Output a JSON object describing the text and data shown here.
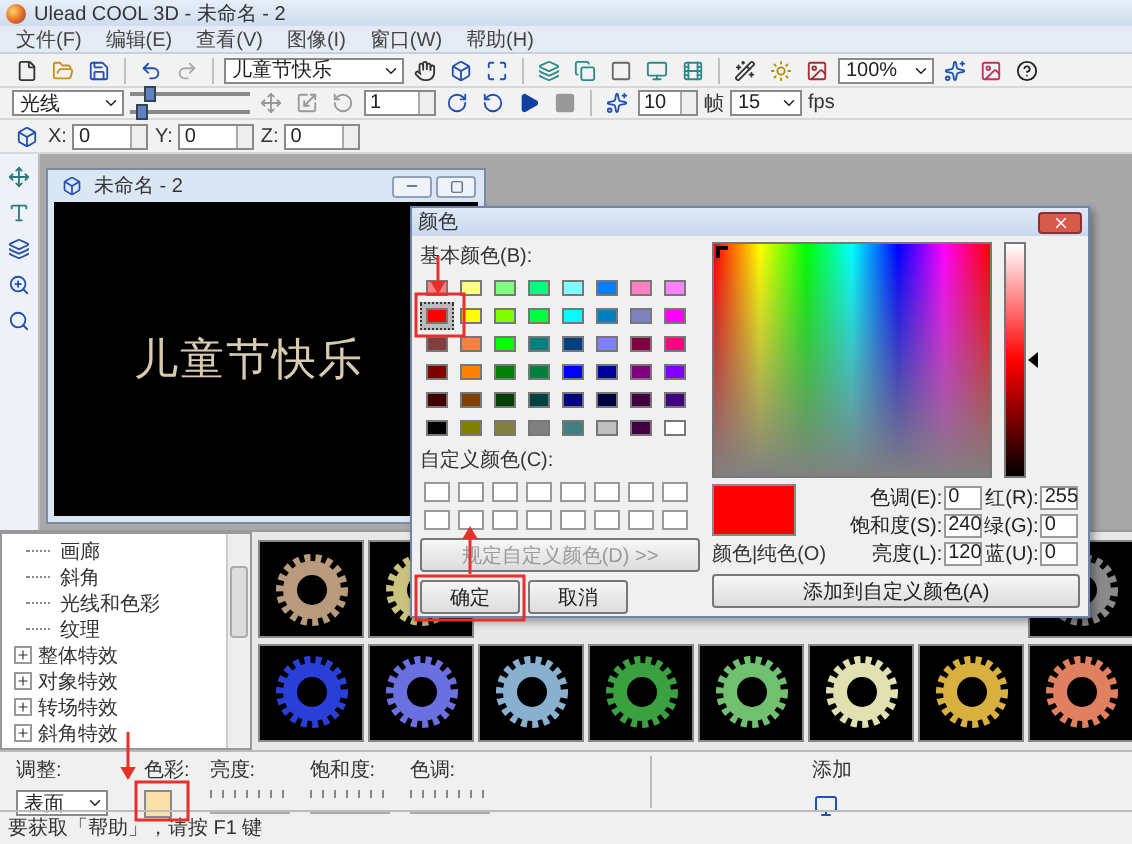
{
  "window": {
    "title": "Ulead COOL 3D - 未命名 - 2"
  },
  "menu": [
    "文件(F)",
    "编辑(E)",
    "查看(V)",
    "图像(I)",
    "窗口(W)",
    "帮助(H)"
  ],
  "toolbar": {
    "text_dropdown": "儿童节快乐",
    "zoom_dropdown": "100%",
    "effect_dropdown": "光线",
    "sliders": [
      {
        "level": 0.12
      },
      {
        "level": 0.05
      }
    ],
    "frame_spinner": "1",
    "frames_spinner": "10",
    "frames_label": "帧",
    "fps_dropdown": "15",
    "fps_label": "fps",
    "coords": [
      {
        "label": "X:",
        "value": "0"
      },
      {
        "label": "Y:",
        "value": "0"
      },
      {
        "label": "Z:",
        "value": "0"
      }
    ]
  },
  "document": {
    "title": "未命名 - 2",
    "canvas_text": "儿童节快乐"
  },
  "color_dialog": {
    "title": "颜色",
    "basic_label": "基本颜色(B):",
    "basic_colors": [
      {
        "color": "#ff8080",
        "selected": false
      },
      {
        "color": "#ffff80",
        "selected": false
      },
      {
        "color": "#80ff80",
        "selected": false
      },
      {
        "color": "#00ff80",
        "selected": false
      },
      {
        "color": "#80ffff",
        "selected": false
      },
      {
        "color": "#0080ff",
        "selected": false
      },
      {
        "color": "#ff80c0",
        "selected": false
      },
      {
        "color": "#ff80ff",
        "selected": false
      },
      {
        "color": "#ff0000",
        "selected": true
      },
      {
        "color": "#ffff00",
        "selected": false
      },
      {
        "color": "#80ff00",
        "selected": false
      },
      {
        "color": "#00ff40",
        "selected": false
      },
      {
        "color": "#00ffff",
        "selected": false
      },
      {
        "color": "#0080c0",
        "selected": false
      },
      {
        "color": "#8080c0",
        "selected": false
      },
      {
        "color": "#ff00ff",
        "selected": false
      },
      {
        "color": "#804040",
        "selected": false
      },
      {
        "color": "#ff8040",
        "selected": false
      },
      {
        "color": "#00ff00",
        "selected": false
      },
      {
        "color": "#008080",
        "selected": false
      },
      {
        "color": "#004080",
        "selected": false
      },
      {
        "color": "#8080ff",
        "selected": false
      },
      {
        "color": "#800040",
        "selected": false
      },
      {
        "color": "#ff0080",
        "selected": false
      },
      {
        "color": "#800000",
        "selected": false
      },
      {
        "color": "#ff8000",
        "selected": false
      },
      {
        "color": "#008000",
        "selected": false
      },
      {
        "color": "#008040",
        "selected": false
      },
      {
        "color": "#0000ff",
        "selected": false
      },
      {
        "color": "#0000a0",
        "selected": false
      },
      {
        "color": "#800080",
        "selected": false
      },
      {
        "color": "#8000ff",
        "selected": false
      },
      {
        "color": "#400000",
        "selected": false
      },
      {
        "color": "#804000",
        "selected": false
      },
      {
        "color": "#004000",
        "selected": false
      },
      {
        "color": "#004040",
        "selected": false
      },
      {
        "color": "#000080",
        "selected": false
      },
      {
        "color": "#000040",
        "selected": false
      },
      {
        "color": "#400040",
        "selected": false
      },
      {
        "color": "#400080",
        "selected": false
      },
      {
        "color": "#000000",
        "selected": false
      },
      {
        "color": "#808000",
        "selected": false
      },
      {
        "color": "#808040",
        "selected": false
      },
      {
        "color": "#808080",
        "selected": false
      },
      {
        "color": "#408080",
        "selected": false
      },
      {
        "color": "#c0c0c0",
        "selected": false
      },
      {
        "color": "#400040",
        "selected": false
      },
      {
        "color": "#ffffff",
        "selected": false
      }
    ],
    "custom_label": "自定义颜色(C):",
    "define_button": {
      "label": "规定自定义颜色(D) >>",
      "disabled": true
    },
    "ok_button": "确定",
    "cancel_button": "取消",
    "preview_label": "颜色|纯色(O)",
    "fields": [
      {
        "label": "色调(E):",
        "value": "0"
      },
      {
        "label": "红(R):",
        "value": "255"
      },
      {
        "label": "饱和度(S):",
        "value": "240"
      },
      {
        "label": "绿(G):",
        "value": "0"
      },
      {
        "label": "亮度(L):",
        "value": "120"
      },
      {
        "label": "蓝(U):",
        "value": "0"
      }
    ],
    "add_button": "添加到自定义颜色(A)"
  },
  "tree": [
    {
      "kind": "leaf",
      "label": "画廊"
    },
    {
      "kind": "leaf",
      "label": "斜角"
    },
    {
      "kind": "leaf",
      "label": "光线和色彩"
    },
    {
      "kind": "leaf",
      "label": "纹理"
    },
    {
      "kind": "group",
      "label": "整体特效",
      "expanded": false
    },
    {
      "kind": "group",
      "label": "对象特效",
      "expanded": false
    },
    {
      "kind": "group",
      "label": "转场特效",
      "expanded": false
    },
    {
      "kind": "group",
      "label": "斜角特效",
      "expanded": false
    }
  ],
  "thumbnails": [
    {
      "kind": "gear",
      "color": "#b89a7c"
    },
    {
      "kind": "gear",
      "color": "#c9c27f"
    },
    {
      "kind": "covered"
    },
    {
      "kind": "covered"
    },
    {
      "kind": "covered"
    },
    {
      "kind": "covered"
    },
    {
      "kind": "covered"
    },
    {
      "kind": "gear",
      "color": "#8a8a8a"
    },
    {
      "kind": "gear",
      "color": "#2a3fd8"
    },
    {
      "kind": "gear",
      "color": "#6a70e0"
    },
    {
      "kind": "gear",
      "color": "#8ab0d0"
    },
    {
      "kind": "gear",
      "color": "#3aa040"
    },
    {
      "kind": "gear",
      "color": "#70c070"
    },
    {
      "kind": "gear",
      "color": "#e0e0b0"
    },
    {
      "kind": "gear",
      "color": "#d8b040"
    },
    {
      "kind": "gear",
      "color": "#e08060"
    }
  ],
  "properties": {
    "adjust_label": "调整:",
    "adjust_value": "表面",
    "color_label": "色彩:",
    "sliders": [
      "亮度:",
      "饱和度:",
      "色调:"
    ],
    "add_label": "添加"
  },
  "status_bar": "要获取「帮助」，请按 F1 键"
}
